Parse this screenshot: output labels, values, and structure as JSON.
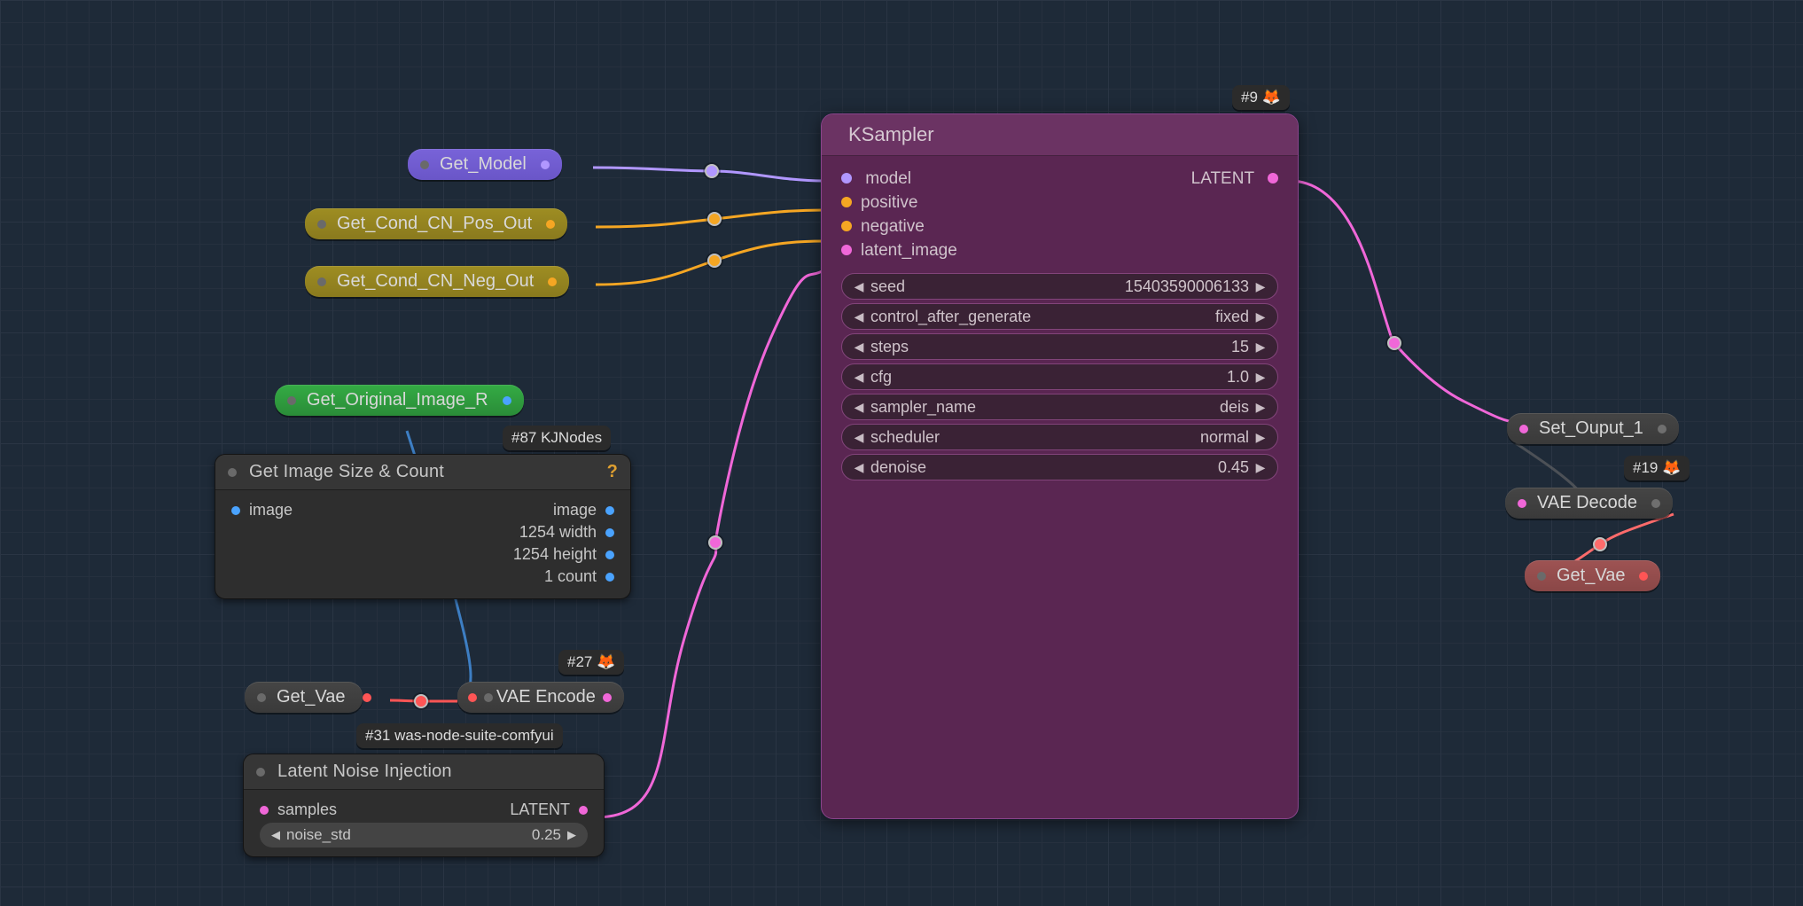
{
  "pills": {
    "get_model": "Get_Model",
    "get_cond_pos": "Get_Cond_CN_Pos_Out",
    "get_cond_neg": "Get_Cond_CN_Neg_Out",
    "get_original_image_r": "Get_Original_Image_R",
    "get_vae_left": "Get_Vae",
    "vae_encode": "VAE Encode",
    "set_output_1": "Set_Ouput_1",
    "vae_decode": "VAE Decode",
    "get_vae_right": "Get_Vae"
  },
  "badges": {
    "ksampler": "#9",
    "kj": "#87 KJNodes",
    "vae_encode": "#27",
    "was": "#31 was-node-suite-comfyui",
    "vae_decode": "#19"
  },
  "ksampler": {
    "title": "KSampler",
    "inputs": {
      "model": "model",
      "positive": "positive",
      "negative": "negative",
      "latent_image": "latent_image"
    },
    "outputs": {
      "latent": "LATENT"
    },
    "seed_label": "seed",
    "seed_value": "15403590006133",
    "cag_label": "control_after_generate",
    "cag_value": "fixed",
    "steps_label": "steps",
    "steps_value": "15",
    "cfg_label": "cfg",
    "cfg_value": "1.0",
    "sampler_label": "sampler_name",
    "sampler_value": "deis",
    "scheduler_label": "scheduler",
    "scheduler_value": "normal",
    "denoise_label": "denoise",
    "denoise_value": "0.45"
  },
  "image_size": {
    "title": "Get Image Size & Count",
    "input": "image",
    "out_image": "image",
    "out_width": "1254 width",
    "out_height": "1254 height",
    "out_count": "1 count"
  },
  "latent_noise": {
    "title": "Latent Noise Injection",
    "input": "samples",
    "output": "LATENT",
    "widget_label": "noise_std",
    "widget_value": "0.25"
  }
}
